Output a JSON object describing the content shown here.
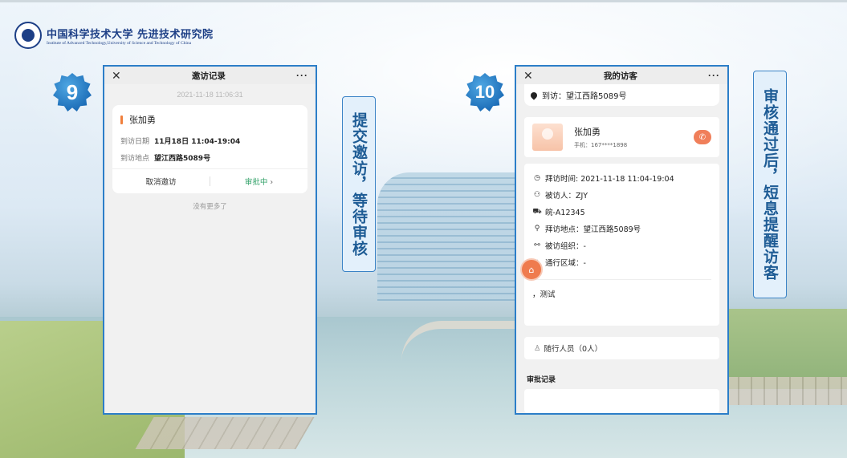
{
  "logo": {
    "cn": "中国科学技术大学 先进技术研究院",
    "en": "Institute of Advanced Technology,University of Science and Technology of China"
  },
  "step1": {
    "badge": "9",
    "nav": {
      "close": "✕",
      "title": "邀访记录",
      "more": "···"
    },
    "timestamp": "2021-11-18 11:06:31",
    "card": {
      "name": "张加勇",
      "date_label": "到访日期",
      "date_value": "11月18日 11:04-19:04",
      "place_label": "到访地点",
      "place_value": "望江西路5089号",
      "cancel": "取消邀访",
      "status": "审批中"
    },
    "no_more": "没有更多了",
    "caption": "提交邀访，等待审核"
  },
  "step2": {
    "badge": "10",
    "nav": {
      "close": "✕",
      "title": "我的访客",
      "more": "···"
    },
    "destination": "到访：望江西路5089号",
    "visitor": {
      "name": "张加勇",
      "phone": "手机：167****1898"
    },
    "details": [
      {
        "icon": "clock-icon",
        "glyph": "◷",
        "text": "拜访时间: 2021-11-18 11:04-19:04"
      },
      {
        "icon": "person-icon",
        "glyph": "⚇",
        "text": "被访人：ZJY"
      },
      {
        "icon": "car-icon",
        "glyph": "⛟",
        "text": "皖-A12345"
      },
      {
        "icon": "location-icon",
        "glyph": "⚲",
        "text": "拜访地点：望江西路5089号"
      },
      {
        "icon": "org-icon",
        "glyph": "⚯",
        "text": "被访组织：-"
      },
      {
        "icon": "area-icon",
        "glyph": "⌂",
        "text": "通行区域：-"
      }
    ],
    "note": "，测试",
    "companions": "随行人员（0人）",
    "approval_section": "审批记录",
    "caption": "审核通过后，短息提醒访客"
  }
}
